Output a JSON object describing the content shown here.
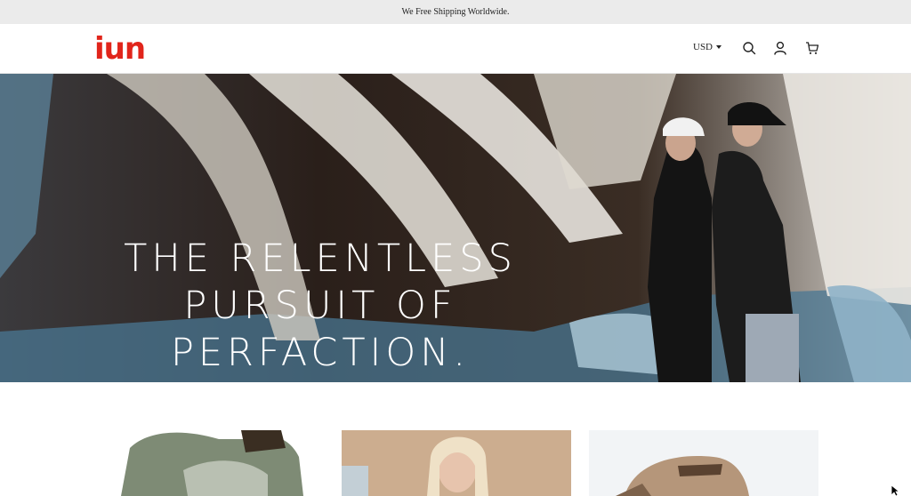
{
  "announcement": "We Free Shipping Worldwide.",
  "header": {
    "logo": "iun",
    "currency": "USD",
    "icons": [
      "search-icon",
      "account-icon",
      "cart-icon"
    ]
  },
  "hero": {
    "headline": [
      "THE RELENTLESS",
      "PURSUIT OF",
      "PERFACTION."
    ]
  },
  "colors": {
    "brand": "#e1251b",
    "announcement_bg": "#ebebeb"
  }
}
